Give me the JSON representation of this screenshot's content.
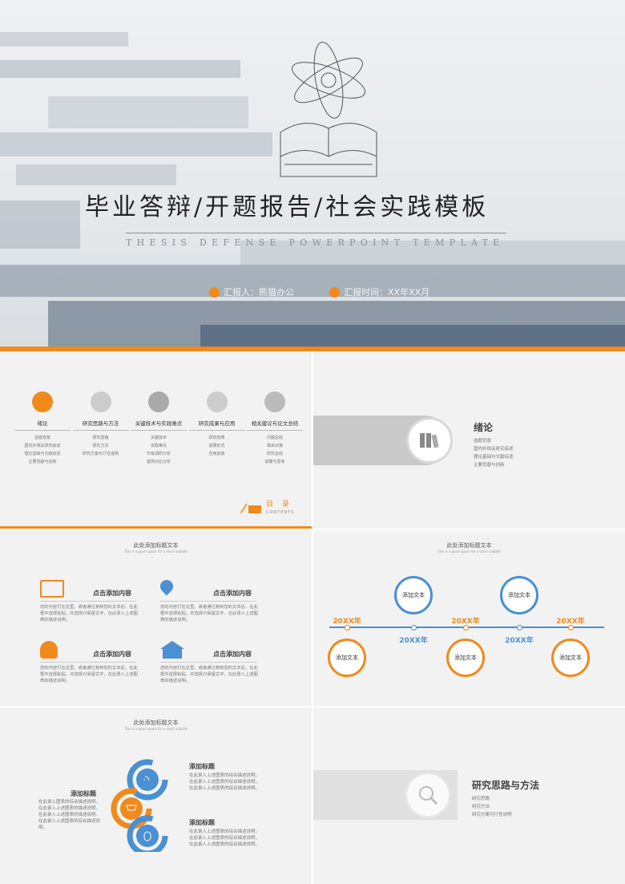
{
  "cover": {
    "title": "毕业答辩/开题报告/社会实践模板",
    "subtitle": "THESIS DEFENSE POWERPOINT TEMPLATE",
    "reporter": "汇报人：熊猫办公",
    "date": "汇报时间：XX年XX月"
  },
  "toc": {
    "sections": [
      {
        "title": "绪论",
        "items": [
          "选题背景",
          "国内外相关研究综述",
          "理论基础与文献综述",
          "主要贡献与创新"
        ]
      },
      {
        "title": "研究思路与方法",
        "items": [
          "研究思路",
          "研究方法",
          "研究方案可行性说明"
        ]
      },
      {
        "title": "关键技术与实践难点",
        "items": [
          "关键技术",
          "实践难点",
          "升级调研分析",
          "案例对比分析"
        ]
      },
      {
        "title": "研究成果与应用",
        "items": [
          "研究结果",
          "成果形式",
          "应用前景"
        ]
      },
      {
        "title": "相关建议与论文总结",
        "items": [
          "问题总结",
          "相关对策",
          "研究总结",
          "前瞻与思考"
        ]
      }
    ],
    "heading": "目 录",
    "heading_en": "CONTENTS"
  },
  "section1": {
    "title": "绪论",
    "items": [
      "选题背景",
      "国内外相关研究综述",
      "理论基础与文献综述",
      "主要贡献与创新"
    ]
  },
  "features": {
    "header": "此处添加标题文本",
    "header_sub": "This is a good space for a short subtitle",
    "items": [
      {
        "title": "点击添加内容",
        "text": "您的内容打在这里，或者通过复制您的文本后，在此框中选择粘贴，并选择只保留文字，在此录入上述图表的描述说明。"
      },
      {
        "title": "点击添加内容",
        "text": "您的内容打在这里，或者通过复制您的文本后，在此框中选择粘贴，并选择只保留文字，在此录入上述图表的描述说明。"
      },
      {
        "title": "点击添加内容",
        "text": "您的内容打在这里，或者通过复制您的文本后，在此框中选择粘贴，并选择只保留文字，在此录入上述图表的描述说明。"
      },
      {
        "title": "点击添加内容",
        "text": "您的内容打在这里，或者通过复制您的文本后，在此框中选择粘贴，并选择只保留文字，在此录入上述图表的描述说明。"
      }
    ]
  },
  "timeline": {
    "header": "此处添加标题文本",
    "header_sub": "This is a good space for a short subtitle",
    "nodes": [
      {
        "year": "20XX年",
        "label": "添加文本",
        "side": "bottom"
      },
      {
        "year": "20XX年",
        "label": "添加文本",
        "side": "top"
      },
      {
        "year": "20XX年",
        "label": "添加文本",
        "side": "bottom"
      },
      {
        "year": "20XX年",
        "label": "添加文本",
        "side": "top"
      },
      {
        "year": "20XX年",
        "label": "添加文本",
        "side": "bottom"
      }
    ],
    "colors": {
      "blue": "#4a90d2",
      "orange": "#f08a1c"
    }
  },
  "cycle": {
    "header": "此处添加标题文本",
    "header_sub": "This is a good space for a short subtitle",
    "left_title": "添加标题",
    "left_text": "在此录入图表的综合描述说明，在此录入上述图表的描述说明，在此录入上述图表的描述说明，在此录入上述图表的综合描述说明。",
    "right": [
      {
        "title": "添加标题",
        "text": "在此录入上述图表的综合描述说明，在此录入上述图表的综合描述说明，在此录入上述图表的综合描述说明。"
      },
      {
        "title": "添加标题",
        "text": "在此录入上述图表的综合描述说明，在此录入上述图表的综合描述说明，在此录入上述图表的综合描述说明。"
      }
    ]
  },
  "section2": {
    "title": "研究思路与方法",
    "items": [
      "研究思路",
      "研究方法",
      "研究方案可行性说明"
    ]
  }
}
